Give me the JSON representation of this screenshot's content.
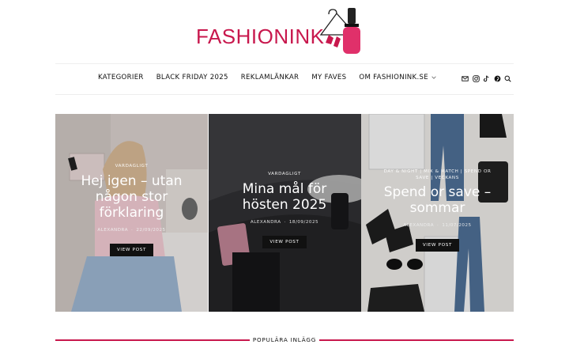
{
  "logo": {
    "text": "FASHIONINK"
  },
  "nav": {
    "items": [
      {
        "label": "KATEGORIER"
      },
      {
        "label": "BLACK FRIDAY 2025"
      },
      {
        "label": "REKLAMLÄNKAR"
      },
      {
        "label": "MY FAVES"
      },
      {
        "label": "OM FASHIONINK.SE"
      }
    ],
    "social_icons": [
      "mail-icon",
      "instagram-icon",
      "tiktok-icon",
      "pinterest-icon",
      "search-icon"
    ]
  },
  "cards": [
    {
      "category": "VARDAGLIGT",
      "title": "Hej igen – utan någon stor förklaring",
      "author": "ALEXANDRA",
      "date": "22/09/2025",
      "button": "VIEW POST"
    },
    {
      "category": "VARDAGLIGT",
      "title": "Mina mål för hösten 2025",
      "author": "ALEXANDRA",
      "date": "18/09/2025",
      "button": "VIEW POST"
    },
    {
      "category": "DAY & NIGHT | MIX & MATCH | SPEND OR SAVE | VECKANS",
      "title": "Spend or save – sommar",
      "author": "ALEXANDRA",
      "date": "11/07/2025",
      "button": "VIEW POST"
    }
  ],
  "popular": {
    "label": "POPULÄRA INLÄGG"
  },
  "colors": {
    "accent": "#c8184d"
  }
}
